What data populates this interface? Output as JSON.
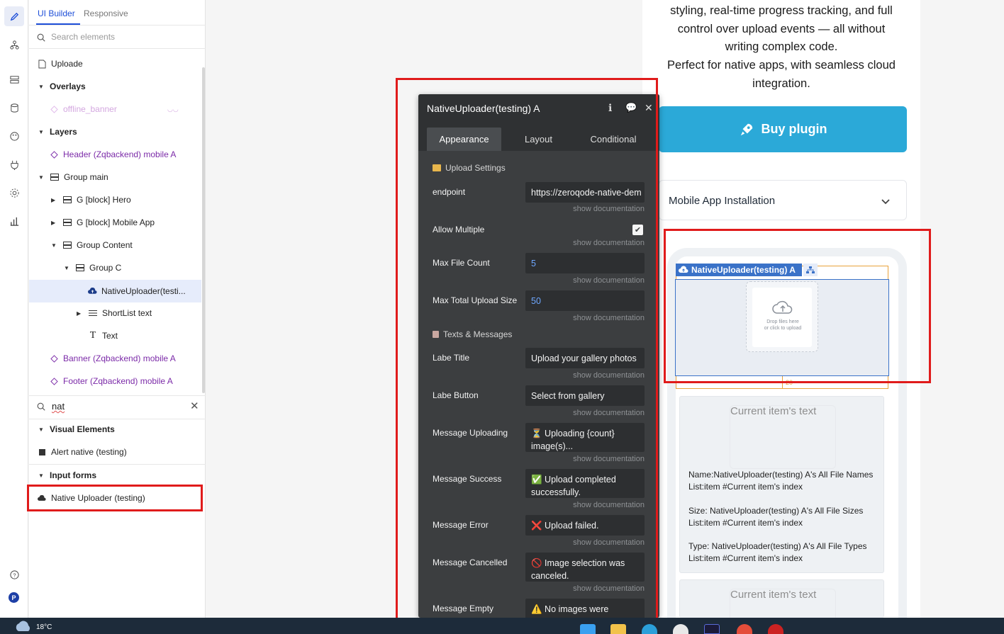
{
  "editor_tabs": {
    "ui_builder": "UI Builder",
    "responsive": "Responsive"
  },
  "search": {
    "placeholder": "Search elements"
  },
  "tree": {
    "page": "Uploade",
    "overlays": "Overlays",
    "offline_banner": "offline_banner",
    "layers": "Layers",
    "header": "Header (Zqbackend) mobile A",
    "group_main": "Group main",
    "hero": "G [block] Hero",
    "mobile_app": "G [block] Mobile App",
    "group_content": "Group Content",
    "group_c": "Group C",
    "native_uploader": "NativeUploader(testi...",
    "shortlist": "ShortList text",
    "text": "Text",
    "banner": "Banner (Zqbackend) mobile A",
    "footer": "Footer (Zqbackend) mobile A"
  },
  "element_search": {
    "query": "nat"
  },
  "results": {
    "visual_elements": "Visual Elements",
    "alert_native": "Alert native (testing)",
    "input_forms": "Input forms",
    "native_uploader": "Native Uploader (testing)"
  },
  "property_editor": {
    "title": "NativeUploader(testing) A",
    "tabs": [
      "Appearance",
      "Layout",
      "Conditional"
    ],
    "sections": {
      "upload_settings": "Upload Settings",
      "texts_messages": "Texts & Messages"
    },
    "show_doc": "show documentation",
    "fields": {
      "endpoint": {
        "label": "endpoint",
        "value": "https://zeroqode-native-dem"
      },
      "allow_multiple": {
        "label": "Allow Multiple",
        "checked": true
      },
      "max_file_count": {
        "label": "Max File Count",
        "value": "5"
      },
      "max_total_upload_size": {
        "label": "Max Total Upload Size",
        "value": "50"
      },
      "labe_title": {
        "label": "Labe Title",
        "value": "Upload your gallery photos"
      },
      "labe_button": {
        "label": "Labe Button",
        "value": "Select from gallery"
      },
      "message_uploading": {
        "label": "Message Uploading",
        "value": "⏳ Uploading {count} image(s)..."
      },
      "message_success": {
        "label": "Message Success",
        "value": "✅ Upload completed successfully."
      },
      "message_error": {
        "label": "Message Error",
        "value": "❌ Upload failed."
      },
      "message_cancelled": {
        "label": "Message Cancelled",
        "value": "🚫 Image selection was canceled."
      },
      "message_empty": {
        "label": "Message Empty",
        "value": "⚠️ No images were"
      }
    }
  },
  "preview": {
    "paragraph_lines": [
      "styling, real-time progress tracking, and full",
      "control over upload events — all without",
      "writing complex code.",
      "Perfect for native apps, with seamless cloud",
      "integration."
    ],
    "buy_button": "Buy plugin",
    "accordion": "Mobile App Installation",
    "uploader_tag": "NativeUploader(testing) A",
    "dropzone_text_1": "Drop files here",
    "dropzone_text_2": "or click to upload",
    "margin_value": "20",
    "card_title": "Current item's text",
    "card_name": "Name:NativeUploader(testing) A's All File Names List:item #Current item's index",
    "card_size": "Size: NativeUploader(testing) A's All File Sizes List:item #Current item's index",
    "card_type": "Type: NativeUploader(testing) A's All File Types List:item #Current item's index"
  },
  "taskbar": {
    "temperature": "18°C"
  },
  "colors": {
    "accent_blue": "#1d4ed8",
    "highlight_red": "#e01b1b",
    "buy_button": "#2ba9d8",
    "editor_bg": "#3c3e40",
    "element_purple": "#7b2aa8"
  }
}
